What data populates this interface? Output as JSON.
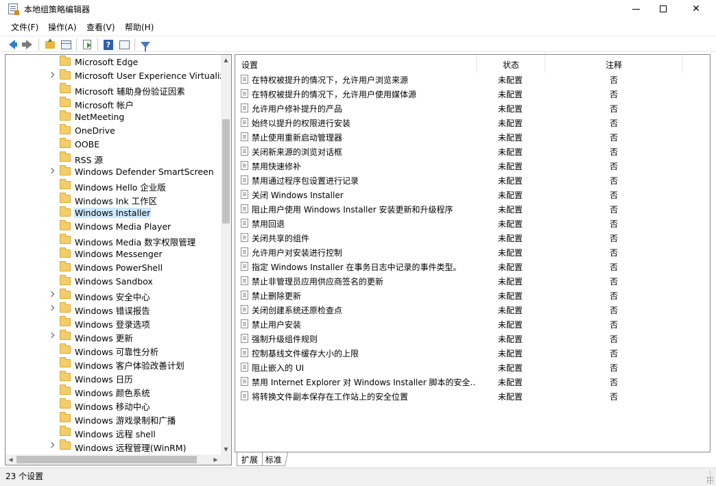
{
  "window": {
    "title": "本地组策略编辑器",
    "minimize": "–",
    "maximize": "□",
    "close": "✕"
  },
  "menu": [
    "文件(F)",
    "操作(A)",
    "查看(V)",
    "帮助(H)"
  ],
  "toolbar": {
    "icons": [
      "back-arrow-icon",
      "forward-arrow-icon",
      "up-folder-icon",
      "show-hide-tree-icon",
      "export-list-icon",
      "help-icon",
      "properties-view-icon",
      "filter-icon"
    ],
    "help_glyph": "?"
  },
  "tree": {
    "selected": "Windows Installer",
    "items": [
      {
        "label": "Microsoft Edge",
        "expandable": false
      },
      {
        "label": "Microsoft User Experience Virtualizat",
        "expandable": true
      },
      {
        "label": "Microsoft 辅助身份验证因素",
        "expandable": false
      },
      {
        "label": "Microsoft 帐户",
        "expandable": false
      },
      {
        "label": "NetMeeting",
        "expandable": false
      },
      {
        "label": "OneDrive",
        "expandable": false
      },
      {
        "label": "OOBE",
        "expandable": false
      },
      {
        "label": "RSS 源",
        "expandable": false
      },
      {
        "label": "Windows Defender SmartScreen",
        "expandable": true
      },
      {
        "label": "Windows Hello 企业版",
        "expandable": false
      },
      {
        "label": "Windows Ink 工作区",
        "expandable": false
      },
      {
        "label": "Windows Installer",
        "expandable": false
      },
      {
        "label": "Windows Media Player",
        "expandable": false
      },
      {
        "label": "Windows Media 数字权限管理",
        "expandable": false
      },
      {
        "label": "Windows Messenger",
        "expandable": false
      },
      {
        "label": "Windows PowerShell",
        "expandable": false
      },
      {
        "label": "Windows Sandbox",
        "expandable": false
      },
      {
        "label": "Windows 安全中心",
        "expandable": true
      },
      {
        "label": "Windows 错误报告",
        "expandable": true
      },
      {
        "label": "Windows 登录选项",
        "expandable": false
      },
      {
        "label": "Windows 更新",
        "expandable": true
      },
      {
        "label": "Windows 可靠性分析",
        "expandable": false
      },
      {
        "label": "Windows 客户体验改善计划",
        "expandable": false
      },
      {
        "label": "Windows 日历",
        "expandable": false
      },
      {
        "label": "Windows 颜色系统",
        "expandable": false
      },
      {
        "label": "Windows 移动中心",
        "expandable": false
      },
      {
        "label": "Windows 游戏录制和广播",
        "expandable": false
      },
      {
        "label": "Windows 远程 shell",
        "expandable": false
      },
      {
        "label": "Windows 远程管理(WinRM)",
        "expandable": true
      }
    ]
  },
  "list": {
    "headers": {
      "setting": "设置",
      "state": "状态",
      "comment": "注释"
    },
    "rows": [
      {
        "name": "在特权被提升的情况下，允许用户浏览来源",
        "state": "未配置",
        "comment": "否"
      },
      {
        "name": "在特权被提升的情况下，允许用户使用媒体源",
        "state": "未配置",
        "comment": "否"
      },
      {
        "name": "允许用户修补提升的产品",
        "state": "未配置",
        "comment": "否"
      },
      {
        "name": "始终以提升的权限进行安装",
        "state": "未配置",
        "comment": "否"
      },
      {
        "name": "禁止使用重新启动管理器",
        "state": "未配置",
        "comment": "否"
      },
      {
        "name": "关闭新来源的浏览对话框",
        "state": "未配置",
        "comment": "否"
      },
      {
        "name": "禁用快速修补",
        "state": "未配置",
        "comment": "否"
      },
      {
        "name": "禁用通过程序包设置进行记录",
        "state": "未配置",
        "comment": "否"
      },
      {
        "name": "关闭 Windows Installer",
        "state": "未配置",
        "comment": "否"
      },
      {
        "name": "阻止用户使用 Windows Installer 安装更新和升级程序",
        "state": "未配置",
        "comment": "否"
      },
      {
        "name": "禁用回退",
        "state": "未配置",
        "comment": "否"
      },
      {
        "name": "关闭共享的组件",
        "state": "未配置",
        "comment": "否"
      },
      {
        "name": "允许用户对安装进行控制",
        "state": "未配置",
        "comment": "否"
      },
      {
        "name": "指定 Windows Installer 在事务日志中记录的事件类型。",
        "state": "未配置",
        "comment": "否"
      },
      {
        "name": "禁止非管理员应用供应商签名的更新",
        "state": "未配置",
        "comment": "否"
      },
      {
        "name": "禁止删除更新",
        "state": "未配置",
        "comment": "否"
      },
      {
        "name": "关闭创建系统还原检查点",
        "state": "未配置",
        "comment": "否"
      },
      {
        "name": "禁止用户安装",
        "state": "未配置",
        "comment": "否"
      },
      {
        "name": "强制升级组件规则",
        "state": "未配置",
        "comment": "否"
      },
      {
        "name": "控制基线文件缓存大小的上限",
        "state": "未配置",
        "comment": "否"
      },
      {
        "name": "阻止嵌入的 UI",
        "state": "未配置",
        "comment": "否"
      },
      {
        "name": "禁用 Internet Explorer 对 Windows Installer 脚本的安全...",
        "state": "未配置",
        "comment": "否"
      },
      {
        "name": "将转换文件副本保存在工作站上的安全位置",
        "state": "未配置",
        "comment": "否"
      }
    ]
  },
  "tabs": [
    "扩展",
    "标准"
  ],
  "status": {
    "text": "23 个设置"
  },
  "scroll": {
    "up": "▲",
    "down": "▼",
    "left": "◀",
    "right": "▶"
  }
}
